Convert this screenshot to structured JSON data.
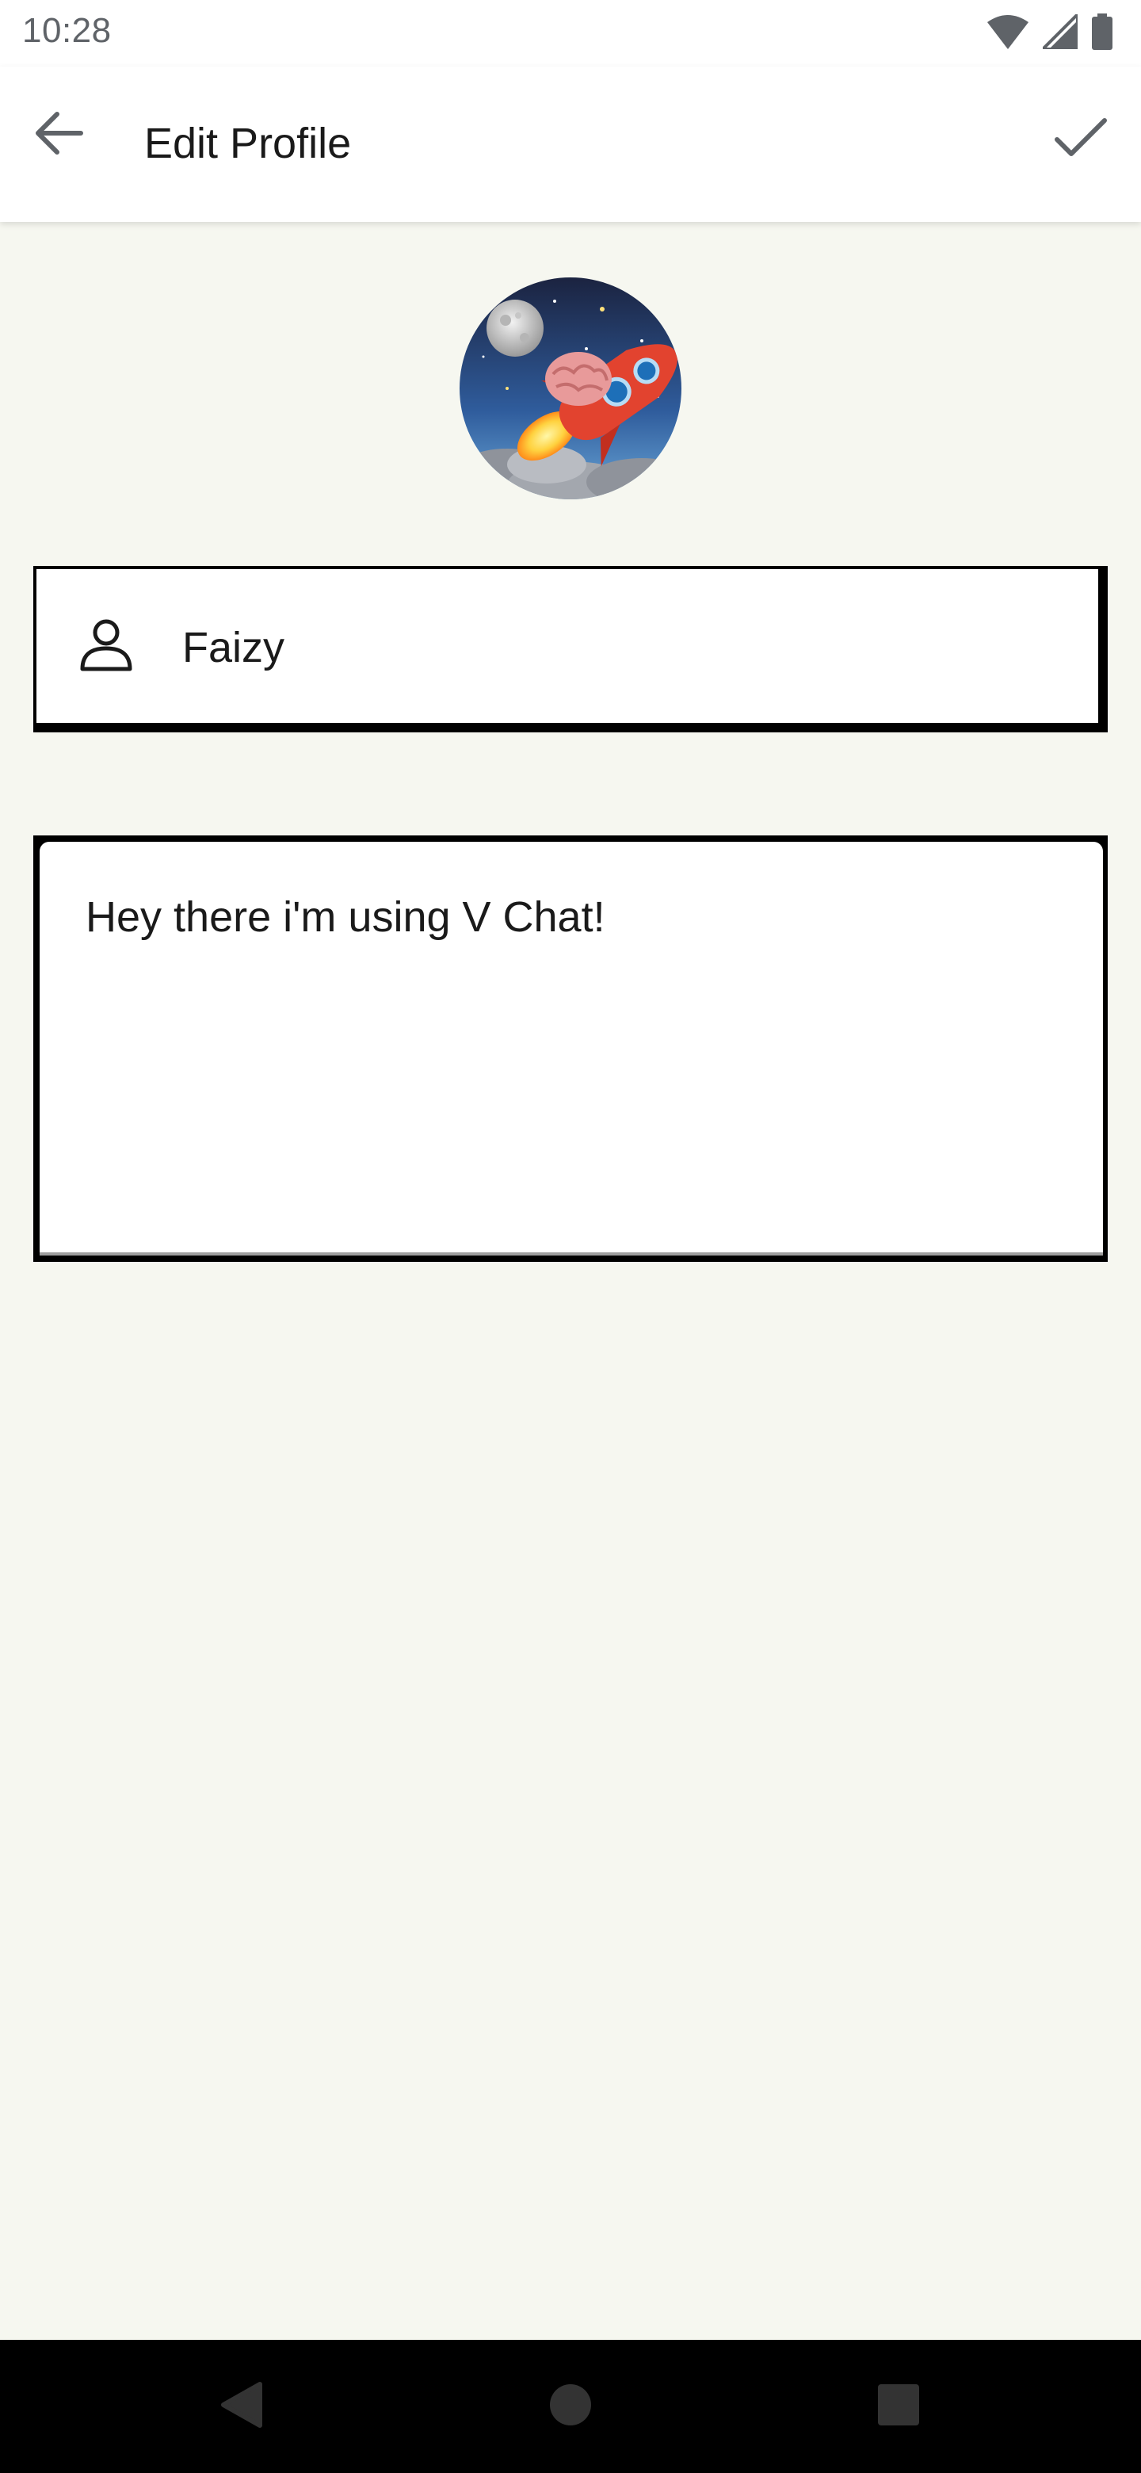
{
  "status_bar": {
    "time": "10:28",
    "icons": [
      "wifi-icon",
      "signal-icon",
      "battery-icon"
    ]
  },
  "app_bar": {
    "title": "Edit Profile",
    "back_icon": "arrow-back-icon",
    "save_icon": "check-icon"
  },
  "profile": {
    "avatar_description": "brain-rocket-avatar",
    "name_icon": "person-icon",
    "name": "Faizy",
    "about": "Hey there i'm using V Chat!"
  },
  "nav_bar": {
    "buttons": [
      "back-triangle-icon",
      "home-circle-icon",
      "recents-square-icon"
    ]
  },
  "colors": {
    "background": "#f6f7f0",
    "surface": "#ffffff",
    "text": "#1a1a1a",
    "icon_grey": "#5f6368",
    "border": "#000000",
    "nav_bar": "#000000",
    "nav_icons": "#333333"
  }
}
